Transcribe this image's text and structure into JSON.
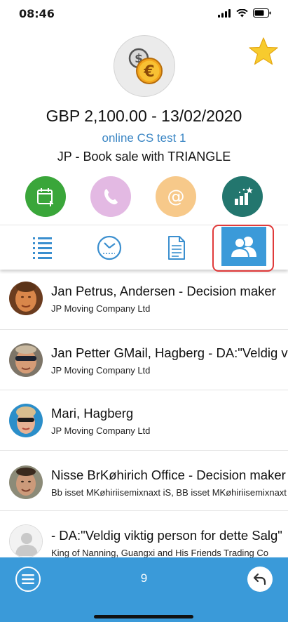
{
  "status_bar": {
    "time": "08:46"
  },
  "header": {
    "amount_line": "GBP 2,100.00 - 13/02/2020",
    "link_text": "online CS test 1",
    "title": "JP - Book sale with TRIANGLE",
    "currency_icon": "dollar-euro-coins-icon",
    "favorite_icon": "star-icon"
  },
  "actions": [
    {
      "name": "calendar-add",
      "color": "#3aa63a"
    },
    {
      "name": "phone",
      "color": "#e3b9e3"
    },
    {
      "name": "email",
      "color": "#f7c98a"
    },
    {
      "name": "stats",
      "color": "#23766e"
    }
  ],
  "tabs": [
    {
      "name": "list"
    },
    {
      "name": "history"
    },
    {
      "name": "document"
    },
    {
      "name": "contacts",
      "active": true
    }
  ],
  "contacts": [
    {
      "name": "Jan Petrus, Andersen - Decision maker",
      "company": "JP Moving Company Ltd"
    },
    {
      "name": "Jan Petter GMail, Hagberg - DA:\"Veldig viktig person\"",
      "company": "JP Moving Company Ltd"
    },
    {
      "name": "Mari, Hagberg",
      "company": "JP Moving Company Ltd"
    },
    {
      "name": "Nisse BrKøhirich Office - Decision maker",
      "company": "Bb isset MKøhiriisemixnaxt iS, BB isset MKøhiriisemixnaxt"
    },
    {
      "name": "- DA:\"Veldig viktig person for dette Salg\"",
      "company": "King of Nanning, Guangxi and His Friends Trading Co"
    }
  ],
  "bottom_bar": {
    "count": "9"
  }
}
